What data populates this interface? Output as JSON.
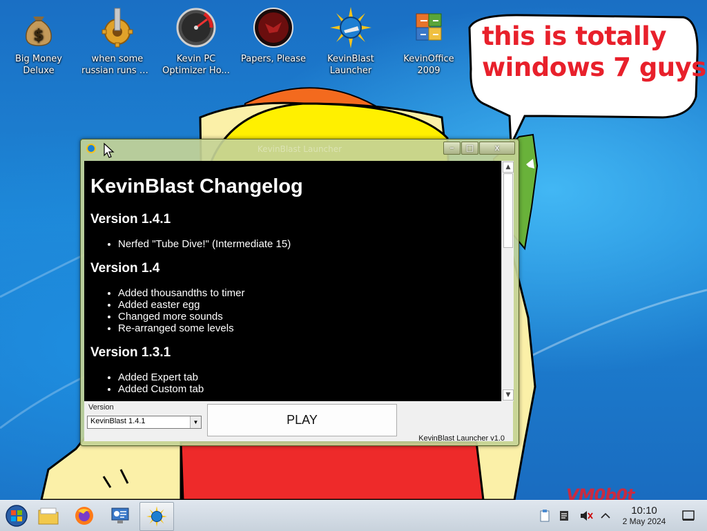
{
  "desktop": {
    "icons": [
      {
        "name": "big-money-deluxe",
        "label_line1": "Big Money",
        "label_line2": "Deluxe"
      },
      {
        "name": "when-some-russian-runs",
        "label_line1": "when some",
        "label_line2": "russian runs a..."
      },
      {
        "name": "kevin-pc-optimizer",
        "label_line1": "Kevin PC",
        "label_line2": "Optimizer Ho..."
      },
      {
        "name": "papers-please",
        "label_line1": "Papers, Please",
        "label_line2": ""
      },
      {
        "name": "kevinblast-launcher",
        "label_line1": "KevinBlast",
        "label_line2": "Launcher"
      },
      {
        "name": "kevinoffice-2009",
        "label_line1": "KevinOffice",
        "label_line2": "2009"
      }
    ],
    "speech_bubble": {
      "line1": "this is totally",
      "line2": "windows 7 guys"
    },
    "watermark": "VM0b0t"
  },
  "window": {
    "title": "KevinBlast Launcher",
    "min_label": "–",
    "max_label": "□",
    "close_label": "x",
    "changelog": {
      "title": "KevinBlast Changelog",
      "sections": [
        {
          "version": "Version 1.4.1",
          "items": [
            "Nerfed \"Tube Dive!\" (Intermediate 15)"
          ]
        },
        {
          "version": "Version 1.4",
          "items": [
            "Added thousandths to timer",
            "Added easter egg",
            "Changed more sounds",
            "Re-arranged some levels"
          ]
        },
        {
          "version": "Version 1.3.1",
          "items": [
            "Added Expert tab",
            "Added Custom tab"
          ]
        }
      ]
    },
    "version_label": "Version",
    "version_selected": "KevinBlast 1.4.1",
    "play_label": "PLAY",
    "launcher_version": "KevinBlast Launcher v1.0"
  },
  "taskbar": {
    "clock_time": "10:10",
    "clock_date": "2 May 2024"
  }
}
